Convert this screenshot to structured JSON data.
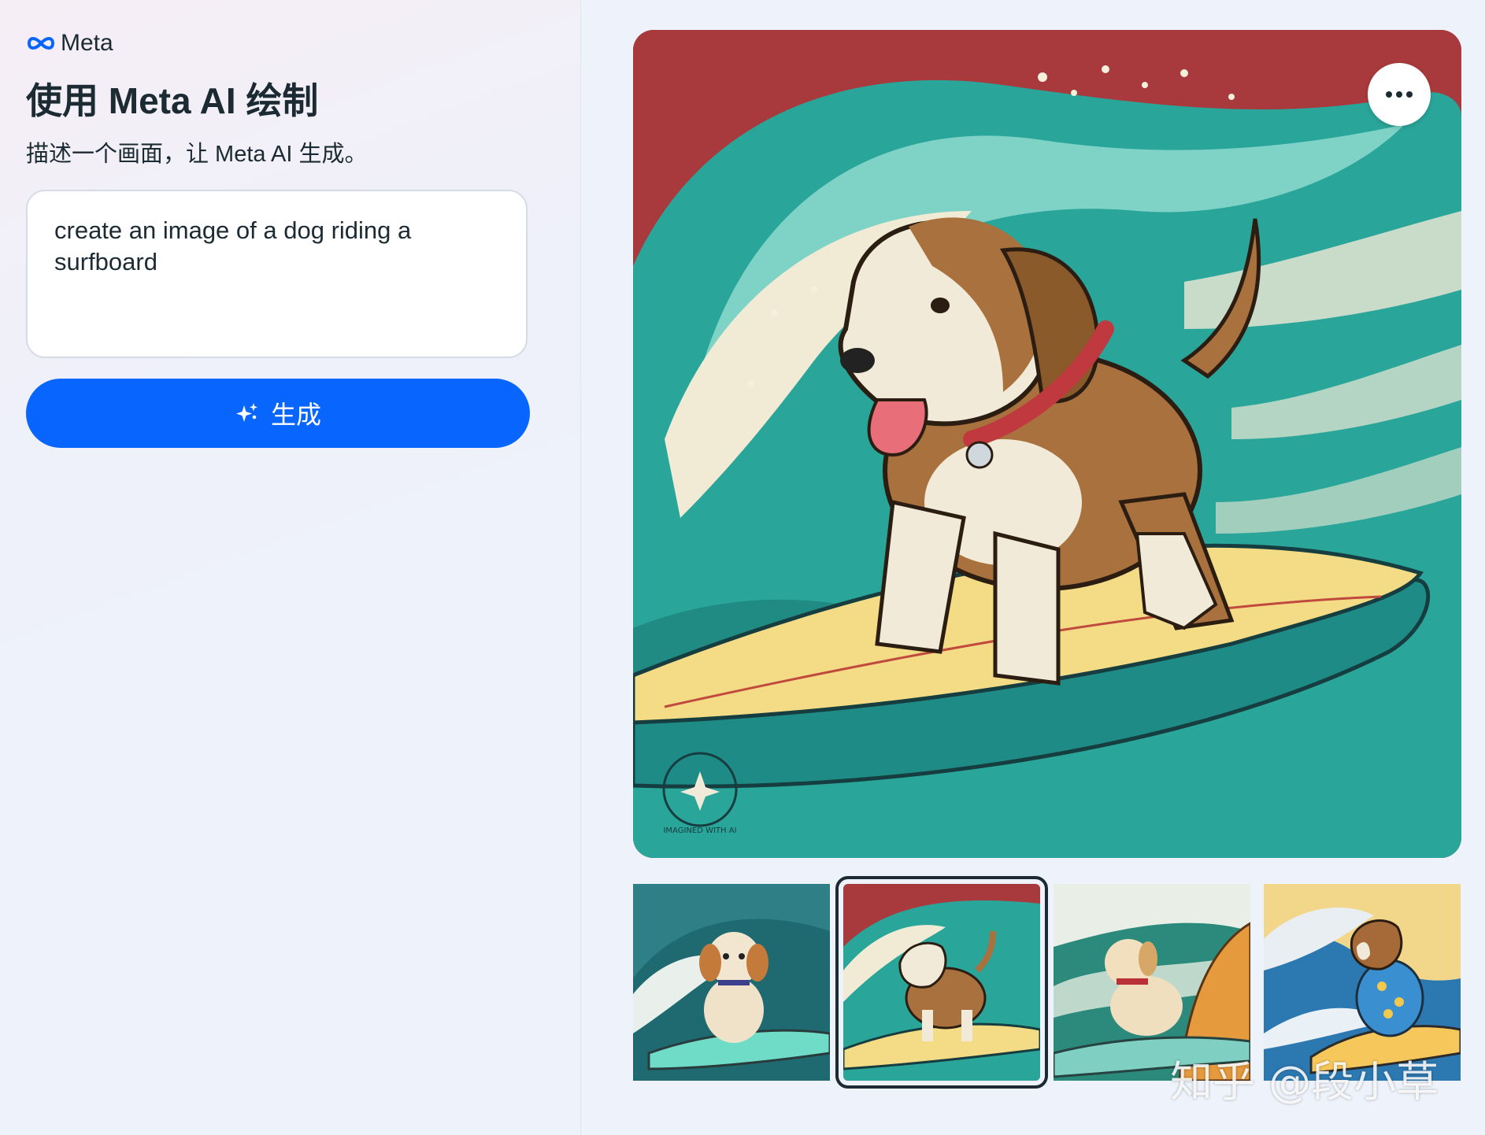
{
  "brand": {
    "logo_icon": "meta-infinity-logo",
    "name": "Meta"
  },
  "header": {
    "title": "使用 Meta AI 绘制",
    "subtitle": "描述一个画面，让 Meta AI 生成。"
  },
  "prompt": {
    "value": "create an image of a dog riding a surfboard"
  },
  "generate_button": {
    "icon": "sparkle-icon",
    "label": "生成"
  },
  "main_image": {
    "badge_text": "IMAGINED WITH AI",
    "more_button_icon": "more-horizontal-icon"
  },
  "thumbnails": [
    {
      "selected": false
    },
    {
      "selected": true
    },
    {
      "selected": false
    },
    {
      "selected": false
    }
  ],
  "watermark": "知乎 @段小草",
  "colors": {
    "accent": "#0866ff",
    "text": "#1c2b33",
    "image_bg_red": "#a8393c",
    "wave_teal": "#2aa59a"
  }
}
